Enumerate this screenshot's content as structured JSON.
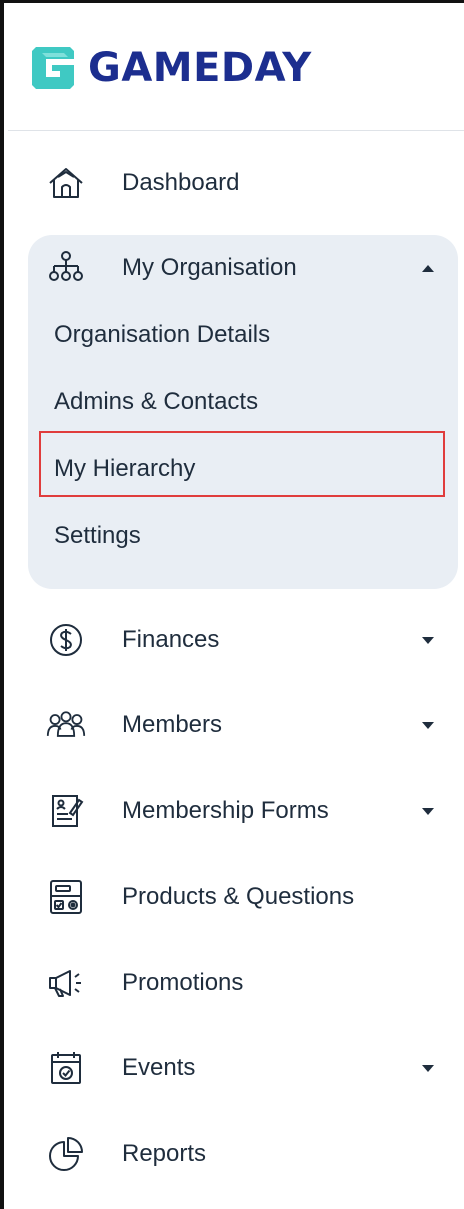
{
  "brand": {
    "name": "GAMEDAY",
    "logo_color": "#3fc9c3",
    "text_color": "#1c2e8f"
  },
  "nav": {
    "dashboard": {
      "label": "Dashboard",
      "icon": "home-icon"
    },
    "my_organisation": {
      "label": "My Organisation",
      "icon": "hierarchy-icon",
      "expanded": true,
      "children": [
        {
          "label": "Organisation Details"
        },
        {
          "label": "Admins & Contacts"
        },
        {
          "label": "My Hierarchy",
          "highlighted": true
        },
        {
          "label": "Settings"
        }
      ]
    },
    "finances": {
      "label": "Finances",
      "icon": "dollar-circle-icon"
    },
    "members": {
      "label": "Members",
      "icon": "members-icon"
    },
    "membership_forms": {
      "label": "Membership Forms",
      "icon": "form-icon"
    },
    "products_questions": {
      "label": "Products & Questions",
      "icon": "products-icon"
    },
    "promotions": {
      "label": "Promotions",
      "icon": "megaphone-icon"
    },
    "events": {
      "label": "Events",
      "icon": "calendar-icon"
    },
    "reports": {
      "label": "Reports",
      "icon": "pie-chart-icon"
    }
  },
  "colors": {
    "group_background": "#e9eef4",
    "highlight_border": "#e03c3c",
    "text": "#1f2d3d"
  }
}
